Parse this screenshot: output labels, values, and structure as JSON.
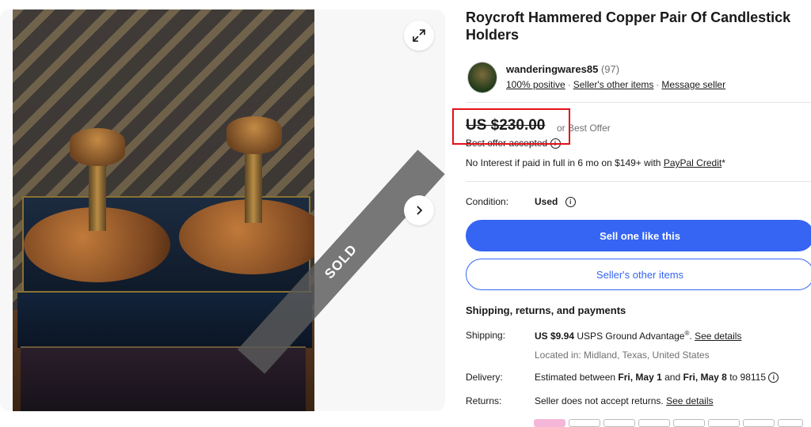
{
  "listing": {
    "title": "Roycroft Hammered Copper Pair Of Candlestick Holders",
    "sold_badge": "SOLD"
  },
  "seller": {
    "name": "wanderingwares85",
    "count": "(97)",
    "positive": "100% positive",
    "other_items": "Seller's other items",
    "message": "Message seller"
  },
  "price": {
    "amount": "US $230.00",
    "or_offer": "or Best Offer",
    "accepted": "Best offer accepted",
    "credit_text": "No Interest if paid in full in 6 mo on $149+ with",
    "credit_link": "PayPal Credit",
    "credit_suffix": "*"
  },
  "condition": {
    "label": "Condition:",
    "value": "Used"
  },
  "buttons": {
    "sell": "Sell one like this",
    "other_items": "Seller's other items"
  },
  "shipping": {
    "heading": "Shipping, returns, and payments",
    "shipping_label": "Shipping:",
    "shipping_cost": "US $9.94",
    "shipping_method": "USPS Ground Advantage",
    "shipping_reg": "®",
    "shipping_link": "See details",
    "location": "Located in: Midland, Texas, United States",
    "delivery_label": "Delivery:",
    "delivery_prefix": "Estimated between",
    "delivery_start": "Fri, May 1",
    "delivery_and": "and",
    "delivery_end": "Fri, May 8",
    "delivery_zip": "to 98115",
    "returns_label": "Returns:",
    "returns_text": "Seller does not accept returns.",
    "returns_link": "See details"
  },
  "icons": {
    "expand": "expand-icon",
    "next": "chevron-right-icon",
    "info": "info-icon"
  },
  "colors": {
    "accent": "#3665f3",
    "highlight_box": "#e4101a"
  }
}
